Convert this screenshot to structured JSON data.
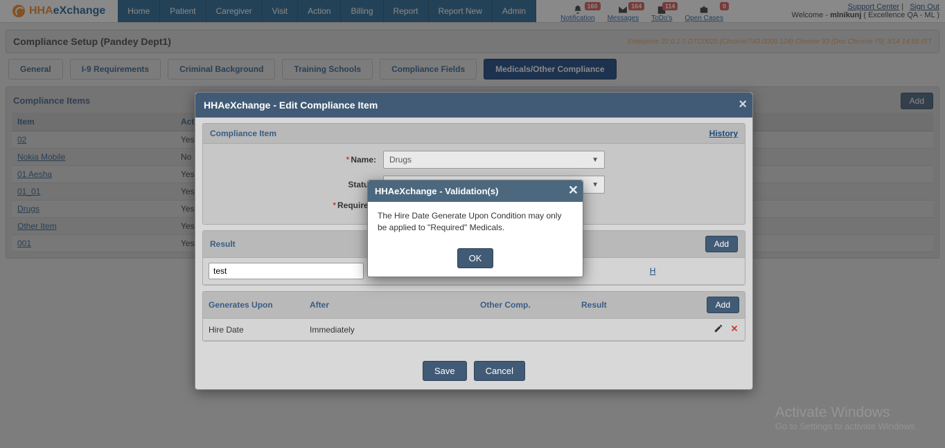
{
  "brand": {
    "h": "HHA",
    "e": "eXchange"
  },
  "nav": [
    "Home",
    "Patient",
    "Caregiver",
    "Visit",
    "Action",
    "Billing",
    "Report",
    "Report New",
    "Admin"
  ],
  "topicons": [
    {
      "label": "Notification",
      "badge": "160"
    },
    {
      "label": "Messages",
      "badge": "164"
    },
    {
      "label": "ToDo's",
      "badge": "114"
    },
    {
      "label": "Open Cases",
      "badge": "0"
    }
  ],
  "toplinks": {
    "support": "Support Center",
    "signout": "Sign Out",
    "welcome_prefix": "Welcome - ",
    "user": "mlnikunj",
    "org": " ( Excellence QA - ML )"
  },
  "page": {
    "title": "Compliance Setup (Pandey Dept1)",
    "envinfo": "Enterprise 22.0.1.0 DTC0025 (Chrome/743.0009.124) Chrome 93 (Doc Chrome 79) 3/14 14:55 IST"
  },
  "subtabs": [
    "General",
    "I-9 Requirements",
    "Criminal Background",
    "Training Schools",
    "Compliance Fields",
    "Medicals/Other Compliance"
  ],
  "active_subtab": 5,
  "compliance_items": {
    "title": "Compliance Items",
    "add": "Add",
    "cols": [
      "Item",
      "Active"
    ],
    "rows": [
      {
        "item": "02",
        "active": "Yes"
      },
      {
        "item": "Nokia Mobile",
        "active": "No"
      },
      {
        "item": "01 Aesha",
        "active": "Yes"
      },
      {
        "item": "01_01",
        "active": "Yes"
      },
      {
        "item": "Drugs",
        "active": "Yes"
      },
      {
        "item": "Other Item",
        "active": "Yes"
      },
      {
        "item": "001",
        "active": "Yes"
      }
    ]
  },
  "modal1": {
    "title": "HHAeXchange - Edit Compliance Item",
    "section1": {
      "title": "Compliance Item",
      "history": "History",
      "fields": {
        "name_label": "Name:",
        "name_value": "Drugs",
        "status_label": "Status:",
        "status_value": "",
        "required_label": "Required:"
      }
    },
    "result": {
      "hdr": "Result",
      "add": "Add",
      "row_value": "test",
      "hcol": "H"
    },
    "gen": {
      "cols": [
        "Generates Upon",
        "After",
        "Other Comp.",
        "Result"
      ],
      "add": "Add",
      "row": {
        "upon": "Hire Date",
        "after": "Immediately",
        "other": "",
        "result": ""
      }
    },
    "save": "Save",
    "cancel": "Cancel"
  },
  "modal2": {
    "title": "HHAeXchange - Validation(s)",
    "msg": "The Hire Date Generate Upon Condition may only be applied to \"Required\" Medicals.",
    "ok": "OK"
  },
  "watermark": {
    "l1": "Activate Windows",
    "l2": "Go to Settings to activate Windows."
  }
}
